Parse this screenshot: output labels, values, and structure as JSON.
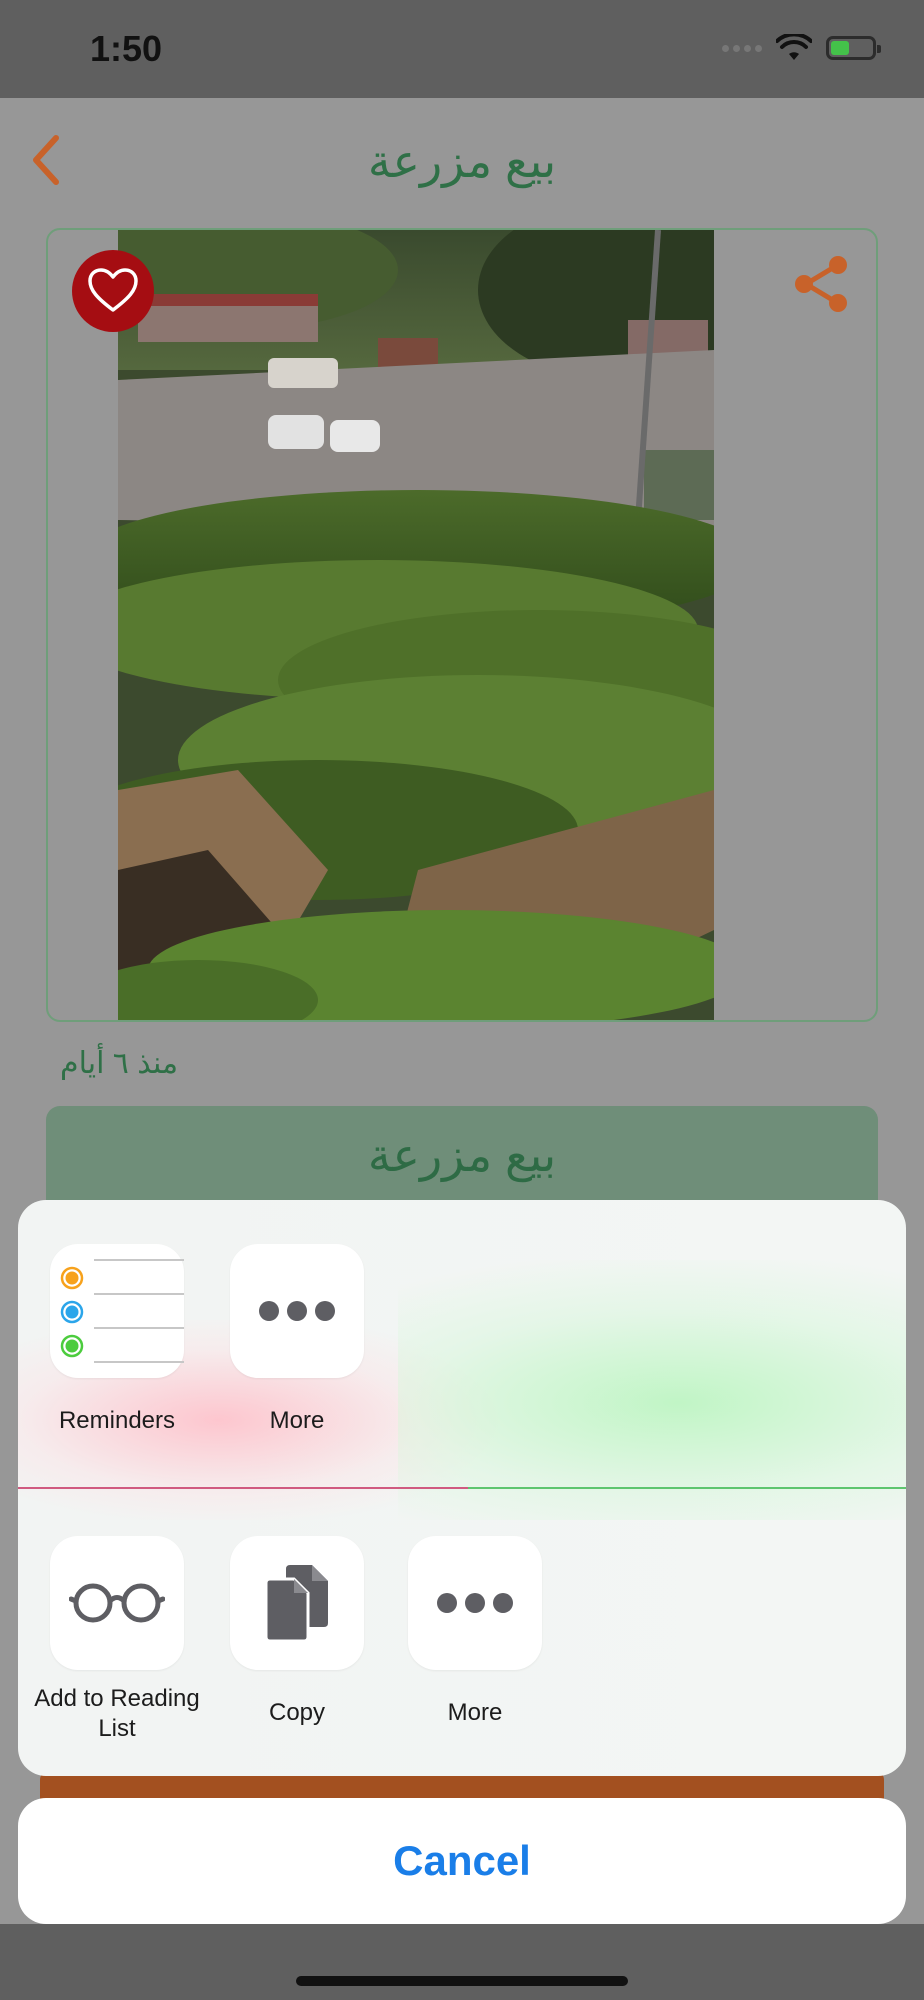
{
  "status_bar": {
    "time": "1:50",
    "icons": [
      "cellular-dots-icon",
      "wifi-icon",
      "battery-charging-icon"
    ]
  },
  "header": {
    "title": "بيع مزرعة",
    "back_icon": "chevron-left-icon"
  },
  "listing": {
    "image_alt": "tea plantation photo",
    "posted": "منذ ٦ أيام",
    "title": "بيع مزرعة",
    "favorite_icon": "heart-icon",
    "share_icon": "share-icon"
  },
  "share_sheet": {
    "apps": [
      {
        "label": "Reminders",
        "icon": "reminders-icon"
      },
      {
        "label": "More",
        "icon": "more-icon"
      }
    ],
    "actions": [
      {
        "label": "Add to Reading List",
        "icon": "glasses-icon"
      },
      {
        "label": "Copy",
        "icon": "copy-icon"
      },
      {
        "label": "More",
        "icon": "more-icon"
      }
    ],
    "cancel": "Cancel"
  },
  "colors": {
    "accent_green": "#2f7047",
    "favorite_red": "#a50d12",
    "share_orange": "#c8622a",
    "cancel_blue": "#1a7ee8",
    "reminder_orange": "#f7a21c",
    "reminder_blue": "#2ba5ea",
    "reminder_green": "#4ccc3e"
  }
}
